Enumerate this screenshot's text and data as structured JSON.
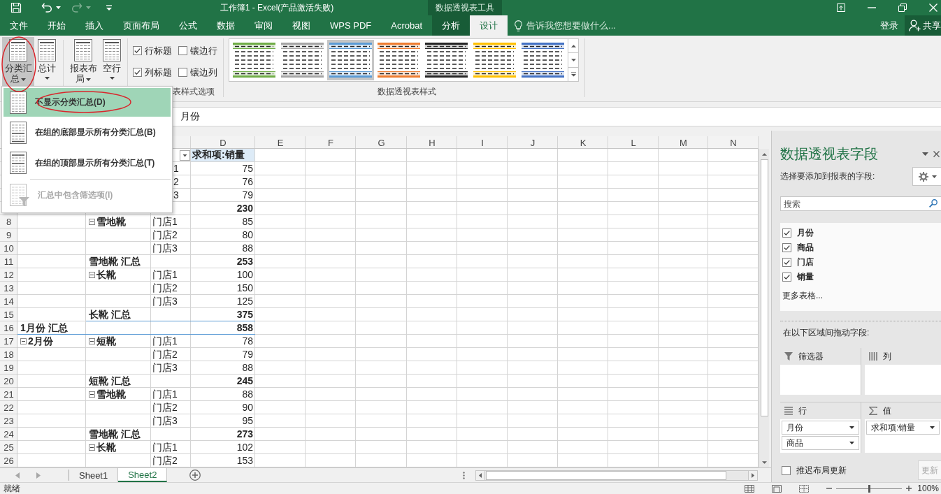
{
  "title_bar": {
    "quick_access": [
      {
        "kind": "save",
        "disabled": false
      },
      {
        "kind": "undo",
        "disabled": false
      },
      {
        "kind": "redo",
        "disabled": true
      },
      {
        "kind": "customize",
        "disabled": false
      }
    ],
    "title": "工作簿1 - Excel(产品激活失败)",
    "context_header": "数据透视表工具"
  },
  "ribbon_tabs": [
    {
      "label": "文件",
      "selected": false,
      "contextual": false
    },
    {
      "label": "开始",
      "selected": false,
      "contextual": false
    },
    {
      "label": "插入",
      "selected": false,
      "contextual": false
    },
    {
      "label": "页面布局",
      "selected": false,
      "contextual": false
    },
    {
      "label": "公式",
      "selected": false,
      "contextual": false
    },
    {
      "label": "数据",
      "selected": false,
      "contextual": false
    },
    {
      "label": "审阅",
      "selected": false,
      "contextual": false
    },
    {
      "label": "视图",
      "selected": false,
      "contextual": false
    },
    {
      "label": "WPS PDF",
      "selected": false,
      "contextual": false
    },
    {
      "label": "Acrobat",
      "selected": false,
      "contextual": false
    },
    {
      "label": "分析",
      "selected": false,
      "contextual": true
    },
    {
      "label": "设计",
      "selected": true,
      "contextual": true
    }
  ],
  "tell_me": {
    "placeholder": "告诉我您想要做什么..."
  },
  "account": {
    "sign_in": "登录",
    "share": "共享"
  },
  "ribbon": {
    "layout_buttons": [
      {
        "label": "分类汇总",
        "pressed": true
      },
      {
        "label": "总计",
        "pressed": false
      },
      {
        "label": "报表布局",
        "pressed": false
      },
      {
        "label": "空行",
        "pressed": false
      }
    ],
    "style_options": {
      "checkboxes": [
        {
          "label": "行标题",
          "checked": true
        },
        {
          "label": "镶边行",
          "checked": false
        },
        {
          "label": "列标题",
          "checked": true
        },
        {
          "label": "镶边列",
          "checked": false
        }
      ],
      "group_label": "表样式选项"
    },
    "styles_gallery": {
      "items": [
        {
          "color": "#70ad47",
          "selected": false
        },
        {
          "color": "#a5a5a5",
          "selected": false
        },
        {
          "color": "#5b9bd5",
          "selected": true
        },
        {
          "color": "#ed7d31",
          "selected": false
        },
        {
          "color": "#262626",
          "selected": false
        },
        {
          "color": "#ffc000",
          "selected": false
        },
        {
          "color": "#4472c4",
          "selected": false
        }
      ],
      "group_label": "数据透视表样式"
    }
  },
  "subtotals_menu": {
    "items": [
      {
        "kind": "none",
        "label": "不显示分类汇总(D)",
        "highlighted": true,
        "disabled": false
      },
      {
        "kind": "bottom",
        "label": "在组的底部显示所有分类汇总(B)",
        "highlighted": false,
        "disabled": false
      },
      {
        "kind": "top",
        "label": "在组的顶部显示所有分类汇总(T)",
        "highlighted": false,
        "disabled": false
      },
      {
        "kind": "filter",
        "label": "汇总中包含筛选项(I)",
        "highlighted": false,
        "disabled": true
      }
    ]
  },
  "formula_bar": {
    "value": "月份"
  },
  "sheet": {
    "columns": [
      "D",
      "E",
      "F",
      "G",
      "H",
      "I",
      "J",
      "K",
      "L",
      "M",
      "N"
    ],
    "rows": [
      {
        "kind": "header",
        "d": "求和项:销量"
      },
      {
        "kind": "item",
        "c": "1",
        "d": "75"
      },
      {
        "kind": "item",
        "c": "2",
        "d": "76"
      },
      {
        "kind": "item",
        "c": "3",
        "d": "79"
      },
      {
        "kind": "subtotal",
        "d": "230"
      },
      {
        "kind": "item",
        "number": "8",
        "b": {
          "text": "雪地靴",
          "expanded": true
        },
        "c": "门店1",
        "d": "85"
      },
      {
        "kind": "item",
        "number": "9",
        "c": "门店2",
        "d": "80"
      },
      {
        "kind": "item",
        "number": "10",
        "c": "门店3",
        "d": "88"
      },
      {
        "kind": "subtotal",
        "number": "11",
        "b": {
          "text": "雪地靴 汇总"
        },
        "d": "253"
      },
      {
        "kind": "item",
        "number": "12",
        "b": {
          "text": "长靴",
          "expanded": true
        },
        "c": "门店1",
        "d": "100"
      },
      {
        "kind": "item",
        "number": "13",
        "c": "门店2",
        "d": "150"
      },
      {
        "kind": "item",
        "number": "14",
        "c": "门店3",
        "d": "125"
      },
      {
        "kind": "subtotal",
        "number": "15",
        "b": {
          "text": "长靴 汇总"
        },
        "d": "375"
      },
      {
        "kind": "group_total",
        "number": "16",
        "a": {
          "text": "1月份 汇总"
        },
        "d": "858"
      },
      {
        "kind": "item",
        "number": "17",
        "a": {
          "text": "2月份",
          "expanded": true
        },
        "b": {
          "text": "短靴",
          "expanded": true
        },
        "c": "门店1",
        "d": "78"
      },
      {
        "kind": "item",
        "number": "18",
        "c": "门店2",
        "d": "79"
      },
      {
        "kind": "item",
        "number": "19",
        "c": "门店3",
        "d": "88"
      },
      {
        "kind": "subtotal",
        "number": "20",
        "b": {
          "text": "短靴 汇总"
        },
        "d": "245"
      },
      {
        "kind": "item",
        "number": "21",
        "b": {
          "text": "雪地靴",
          "expanded": true
        },
        "c": "门店1",
        "d": "88"
      },
      {
        "kind": "item",
        "number": "22",
        "c": "门店2",
        "d": "90"
      },
      {
        "kind": "item",
        "number": "23",
        "c": "门店3",
        "d": "95"
      },
      {
        "kind": "subtotal",
        "number": "24",
        "b": {
          "text": "雪地靴 汇总"
        },
        "d": "273"
      },
      {
        "kind": "item",
        "number": "25",
        "b": {
          "text": "长靴",
          "expanded": true
        },
        "c": "门店1",
        "d": "102"
      },
      {
        "kind": "item",
        "number": "26",
        "c": "门店2",
        "d": "153"
      }
    ]
  },
  "sheet_tabs": [
    {
      "label": "Sheet1",
      "selected": false
    },
    {
      "label": "Sheet2",
      "selected": true
    }
  ],
  "field_pane": {
    "title": "数据透视表字段",
    "prompt": "选择要添加到报表的字段:",
    "search": {
      "placeholder": "搜索"
    },
    "fields": [
      {
        "label": "月份",
        "checked": true
      },
      {
        "label": "商品",
        "checked": true
      },
      {
        "label": "门店",
        "checked": true
      },
      {
        "label": "销量",
        "checked": true
      }
    ],
    "more_tables": "更多表格...",
    "areas_prompt": "在以下区域间拖动字段:",
    "areas": [
      {
        "kind": "filters",
        "label": "筛选器"
      },
      {
        "kind": "columns",
        "label": "列"
      },
      {
        "kind": "rows",
        "label": "行",
        "items": [
          {
            "label": "月份"
          },
          {
            "label": "商品"
          }
        ]
      },
      {
        "kind": "values",
        "label": "值",
        "items": [
          {
            "label": "求和项:销量"
          }
        ]
      }
    ],
    "defer_update": {
      "label": "推迟布局更新",
      "checked": false
    },
    "update_button": {
      "label": "更新",
      "disabled": true
    }
  },
  "status_bar": {
    "status": "就绪",
    "zoom_slider": {
      "level": 0.5
    },
    "zoom": "100%"
  }
}
